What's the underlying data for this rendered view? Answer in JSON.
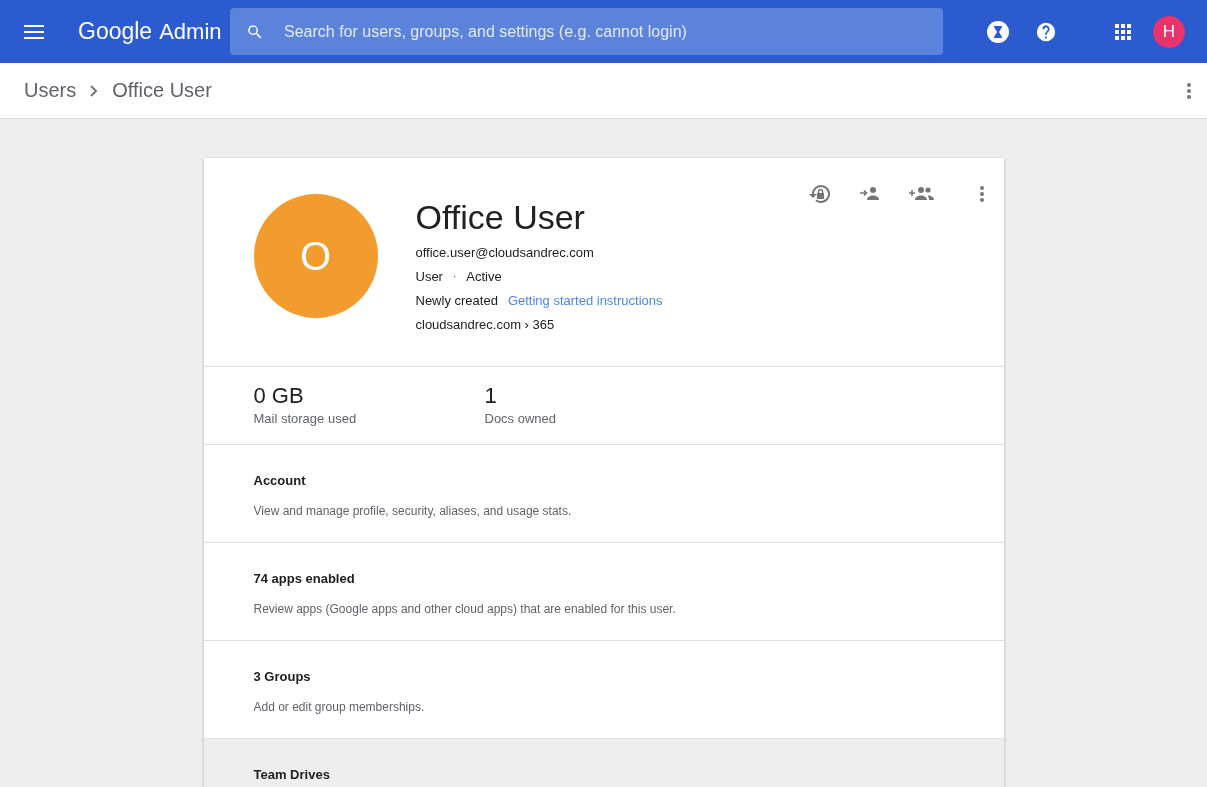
{
  "header": {
    "logo_word": "Google",
    "logo_product": "Admin",
    "search": {
      "placeholder": "Search for users, groups, and settings (e.g. cannot login)"
    },
    "account_initial": "H"
  },
  "breadcrumb": [
    "Users",
    "Office User"
  ],
  "profile": {
    "initial": "O",
    "name": "Office User",
    "email": "office.user@cloudsandrec.com",
    "role": "User",
    "separator": "·",
    "status": "Active",
    "note": "Newly created",
    "link": "Getting started instructions",
    "org_path": "cloudsandrec.com › 365"
  },
  "stats": [
    {
      "value": "0 GB",
      "label": "Mail storage used"
    },
    {
      "value": "1",
      "label": "Docs owned"
    }
  ],
  "sections": [
    {
      "title": "Account",
      "description": "View and manage profile, security, aliases, and usage stats.",
      "hovered": false
    },
    {
      "title": "74 apps enabled",
      "description": "Review apps (Google apps and other cloud apps) that are enabled for this user.",
      "hovered": false
    },
    {
      "title": "3 Groups",
      "description": "Add or edit group memberships.",
      "hovered": false
    },
    {
      "title": "Team Drives",
      "hovered": true
    }
  ]
}
